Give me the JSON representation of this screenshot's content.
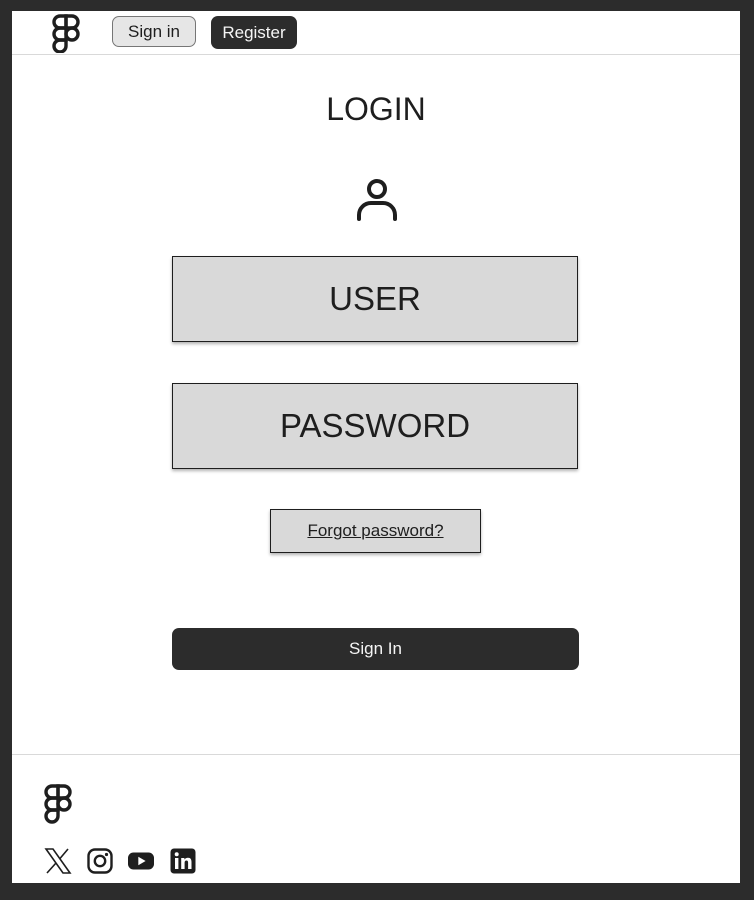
{
  "header": {
    "logo_icon": "figma-logo-icon",
    "sign_in_label": "Sign in",
    "register_label": "Register"
  },
  "main": {
    "title": "LOGIN",
    "user_icon": "user-icon",
    "user_field_label": "USER",
    "password_field_label": "PASSWORD",
    "forgot_password_label": "Forgot password?",
    "sign_in_button_label": "Sign In"
  },
  "footer": {
    "logo_icon": "figma-logo-icon",
    "social_icons": [
      "x-icon",
      "instagram-icon",
      "youtube-icon",
      "linkedin-icon"
    ]
  },
  "colors": {
    "dark": "#2c2c2c",
    "field_bg": "#d9d9d9",
    "text": "#1e1e1e"
  }
}
